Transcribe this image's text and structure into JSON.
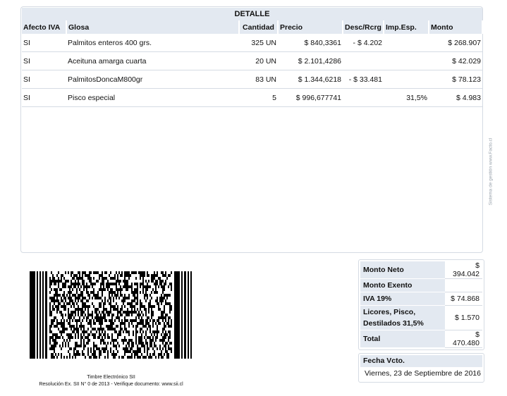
{
  "detalle": {
    "title": "DETALLE",
    "headers": {
      "afecto": "Afecto IVA",
      "glosa": "Glosa",
      "cantidad": "Cantidad",
      "precio": "Precio",
      "desc": "Desc/Rcrg",
      "imp": "Imp.Esp.",
      "monto": "Monto"
    },
    "rows": [
      {
        "afecto": "SI",
        "glosa": "Palmitos enteros 400 grs.",
        "cantidad": "325 UN",
        "precio": "$ 840,3361",
        "desc": "- $ 4.202",
        "imp": "",
        "monto": "$ 268.907"
      },
      {
        "afecto": "SI",
        "glosa": "Aceituna amarga cuarta",
        "cantidad": "20 UN",
        "precio": "$ 2.101,4286",
        "desc": "",
        "imp": "",
        "monto": "$ 42.029"
      },
      {
        "afecto": "SI",
        "glosa": "PalmitosDoncaM800gr",
        "cantidad": "83 UN",
        "precio": "$ 1.344,6218",
        "desc": "- $ 33.481",
        "imp": "",
        "monto": "$ 78.123"
      },
      {
        "afecto": "SI",
        "glosa": "Pisco especial",
        "cantidad": "5",
        "precio": "$ 996,677741",
        "desc": "",
        "imp": "31,5%",
        "monto": "$ 4.983"
      }
    ]
  },
  "side_credit": "Sistema de gestión www.Facto.cl",
  "timbre": {
    "line1": "Timbre Electrónico SII",
    "line2": "Resolución Ex. SII N° 0 de 2013 - Verifique documento: www.sii.cl"
  },
  "totals": {
    "neto_label": "Monto Neto",
    "neto_value": "$ 394.042",
    "exento_label": "Monto Exento",
    "exento_value": "",
    "iva_label": "IVA 19%",
    "iva_value": "$ 74.868",
    "licores_label_1": "Licores, Pisco,",
    "licores_label_2": "Destilados 31,5%",
    "licores_value": "$ 1.570",
    "total_label": "Total",
    "total_value": "$ 470.480"
  },
  "vencimiento": {
    "label": "Fecha Vcto.",
    "value": "Viernes, 23 de Septiembre de 2016"
  },
  "colors": {
    "header_bg": "#e3e9f1",
    "border": "#d5dbe3"
  }
}
